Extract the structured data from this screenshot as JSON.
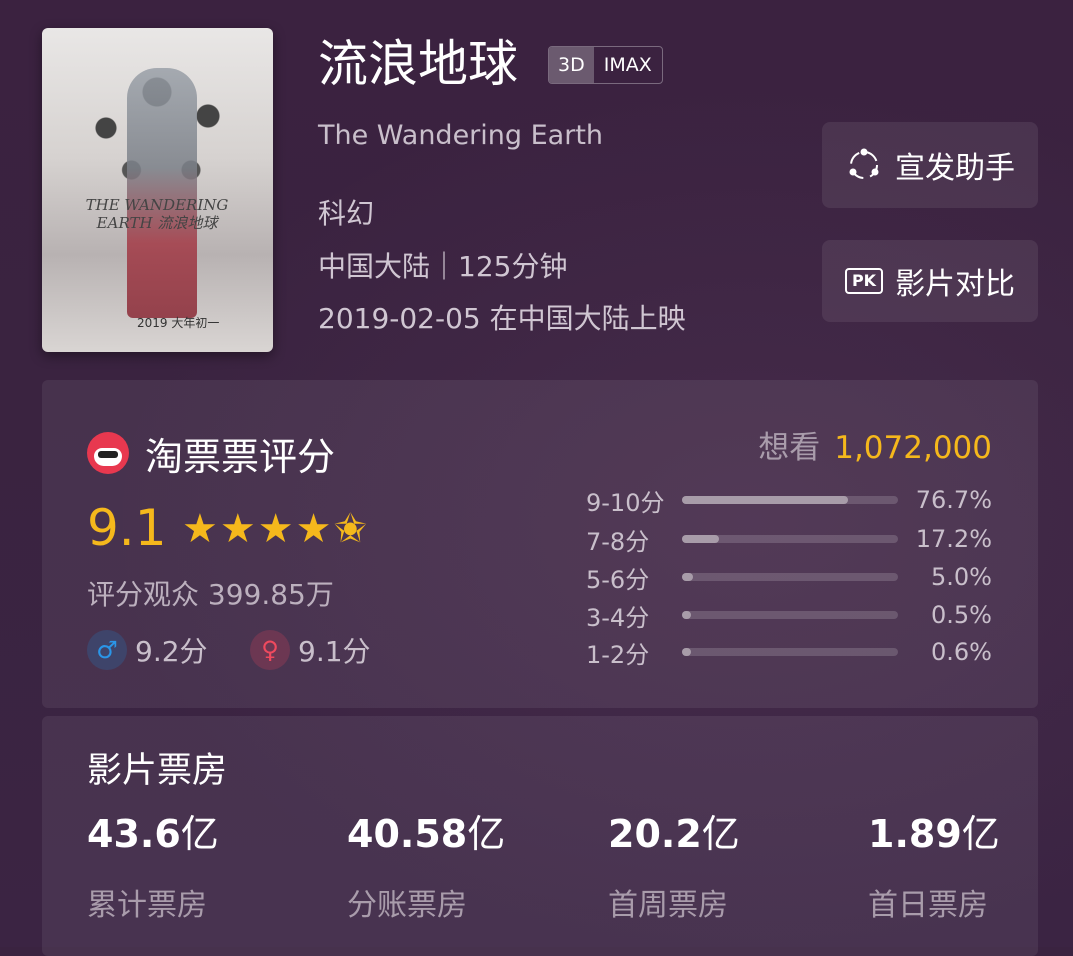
{
  "movie": {
    "title": "流浪地球",
    "formats": [
      "3D",
      "IMAX"
    ],
    "english_title": "The Wandering Earth",
    "genre": "科幻",
    "region_duration": "中国大陆｜125分钟",
    "release": "2019-02-05 在中国大陆上映",
    "poster": {
      "title_text": "THE WANDERING EARTH 流浪地球",
      "year_text": "2019 大年初一"
    }
  },
  "actions": {
    "promo_label": "宣发助手",
    "compare_icon": "PK",
    "compare_label": "影片对比"
  },
  "rating": {
    "source_label": "淘票票评分",
    "score": "9.1",
    "stars": 4.5,
    "stars_text": "★★★★✬",
    "audience": "评分观众 399.85万",
    "male_score": "9.2分",
    "female_score": "9.1分",
    "male_icon": "♂",
    "female_icon": "♀",
    "want_label": "想看",
    "want_count": "1,072,000",
    "distribution": [
      {
        "range": "9-10分",
        "percent_text": "76.7%",
        "percent": 76.7
      },
      {
        "range": "7-8分",
        "percent_text": "17.2%",
        "percent": 17.2
      },
      {
        "range": "5-6分",
        "percent_text": "5.0%",
        "percent": 5.0
      },
      {
        "range": "3-4分",
        "percent_text": "0.5%",
        "percent": 0.5
      },
      {
        "range": "1-2分",
        "percent_text": "0.6%",
        "percent": 0.6
      }
    ]
  },
  "box_office": {
    "heading": "影片票房",
    "items": [
      {
        "value": "43.6",
        "unit": "亿",
        "label": "累计票房"
      },
      {
        "value": "40.58",
        "unit": "亿",
        "label": "分账票房"
      },
      {
        "value": "20.2",
        "unit": "亿",
        "label": "首周票房"
      },
      {
        "value": "1.89",
        "unit": "亿",
        "label": "首日票房"
      }
    ]
  },
  "colors": {
    "background": "#3a2340",
    "accent_gold": "#f5b81c",
    "male_blue": "#2a96e8",
    "female_red": "#f04a5e",
    "brand_red": "#e8384f"
  },
  "icons": [
    "promo-share-icon",
    "pk-compare-icon",
    "taopiaopiao-logo-icon",
    "star-icon",
    "male-icon",
    "female-icon"
  ]
}
